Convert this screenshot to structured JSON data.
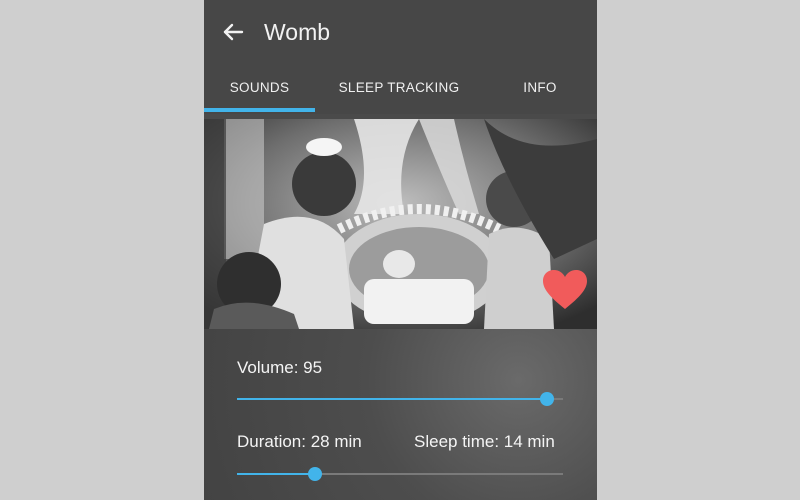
{
  "app": {
    "title": "Womb",
    "back_icon": "arrow-left-icon"
  },
  "tabs": [
    {
      "label": "SOUNDS",
      "selected": true
    },
    {
      "label": "SLEEP TRACKING",
      "selected": false
    },
    {
      "label": "INFO",
      "selected": false
    }
  ],
  "photo": {
    "favorite_icon": "heart-icon",
    "favorite_color": "#f15b5b"
  },
  "volume": {
    "label": "Volume: 95",
    "value": 95,
    "max": 100
  },
  "duration": {
    "label": "Duration: 28 min",
    "value_fraction": 0.24
  },
  "sleep_time": {
    "label": "Sleep time: 14 min"
  },
  "colors": {
    "accent": "#42b4ea",
    "background": "#474747"
  }
}
